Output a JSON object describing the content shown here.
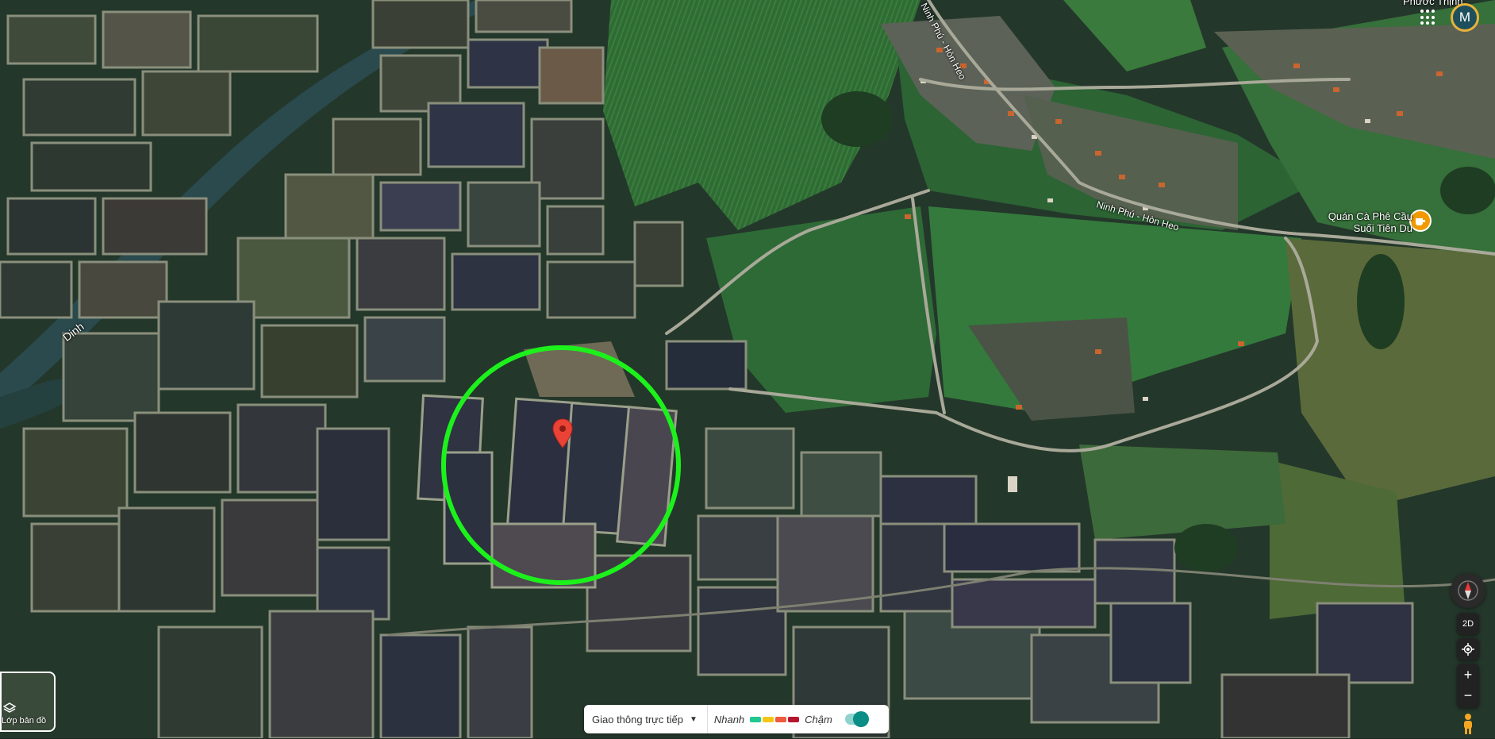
{
  "map": {
    "river_label": "Dinh",
    "road_labels": [
      "Ninh Phú - Hòn Heo",
      "Ninh Phú - Hòn Heo"
    ],
    "place_label": "Phước Thịnh",
    "poi": {
      "name_line1": "Quán Cà Phê Cầu",
      "name_line2": "Suối Tiên Du",
      "icon": "coffee-icon",
      "color": "#f29900"
    },
    "marker": {
      "icon": "map-pin-icon",
      "color": "#ea4335"
    },
    "highlight_circle_color": "#1cf11c"
  },
  "account": {
    "initial": "M"
  },
  "apps_icon": "apps-grid-icon",
  "layers": {
    "label": "Lớp bản đồ",
    "icon": "layers-icon"
  },
  "traffic": {
    "dropdown_label": "Giao thông trực tiếp",
    "fast_label": "Nhanh",
    "slow_label": "Chậm",
    "colors": [
      "#1fc98e",
      "#f5c518",
      "#ef5a3c",
      "#b7142e"
    ]
  },
  "controls": {
    "compass_icon": "compass-icon",
    "view_mode_label": "2D",
    "locate_icon": "my-location-icon",
    "zoom_in_label": "+",
    "zoom_out_label": "−",
    "pegman_icon": "street-view-pegman-icon"
  }
}
